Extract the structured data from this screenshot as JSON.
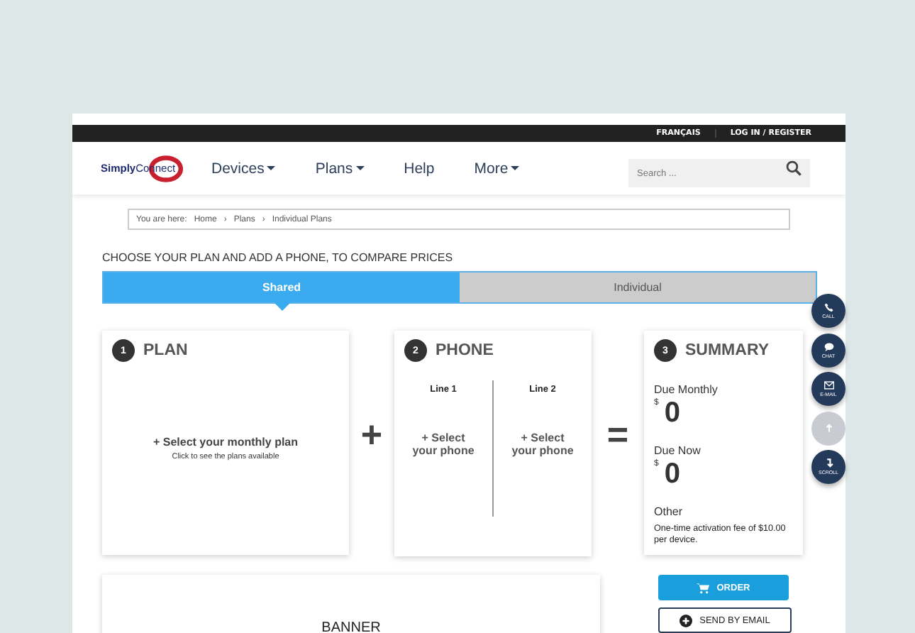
{
  "top_bar": {
    "links": [
      "FRANÇAIS",
      "LOG IN / REGISTER"
    ]
  },
  "logo": {
    "text_1": "Simply",
    "text_2": "Connect"
  },
  "nav": {
    "items": [
      {
        "label": "Devices",
        "dropdown": true
      },
      {
        "label": "Plans",
        "dropdown": true
      },
      {
        "label": "Help",
        "dropdown": false
      },
      {
        "label": "More",
        "dropdown": true
      }
    ]
  },
  "search": {
    "placeholder": "Search ..."
  },
  "breadcrumb": {
    "prefix": "You are here:",
    "items": [
      "Home",
      "Plans",
      "Individual Plans"
    ],
    "separator": "›"
  },
  "heading": "CHOOSE YOUR PLAN AND ADD A PHONE, TO COMPARE PRICES",
  "tabs": [
    {
      "label": "Shared",
      "selected": true
    },
    {
      "label": "Individual",
      "selected": false
    }
  ],
  "plan": {
    "number": "1",
    "title": "PLAN",
    "action": "+ Select your monthly plan",
    "hint": "Click to see the plans available"
  },
  "plus": "+",
  "phone": {
    "number": "2",
    "title": "PHONE",
    "lines": [
      {
        "label": "Line 1",
        "action": "+ Select your phone"
      },
      {
        "label": "Line 2",
        "action": "+ Select your phone"
      }
    ]
  },
  "equals": "=",
  "summary": {
    "number": "3",
    "title": "SUMMARY",
    "due_monthly": {
      "label": "Due Monthly",
      "currency": "$",
      "amount": "0"
    },
    "due_now": {
      "label": "Due Now",
      "currency": "$",
      "amount": "0"
    },
    "other": {
      "label": "Other",
      "note": "One-time activation fee of $10.00 per device."
    }
  },
  "banner": "BANNER",
  "buttons": [
    {
      "kind": "order",
      "label": "ORDER"
    },
    {
      "kind": "email",
      "label": "SEND BY EMAIL"
    }
  ],
  "side_buttons": [
    {
      "kind": "call",
      "label": "CALL",
      "disabled": false
    },
    {
      "kind": "chat",
      "label": "CHAT",
      "disabled": false
    },
    {
      "kind": "email",
      "label": "E-MAIL",
      "disabled": false
    },
    {
      "kind": "up",
      "disabled": true
    },
    {
      "kind": "scroll",
      "label": "SCROLL",
      "disabled": false
    }
  ]
}
